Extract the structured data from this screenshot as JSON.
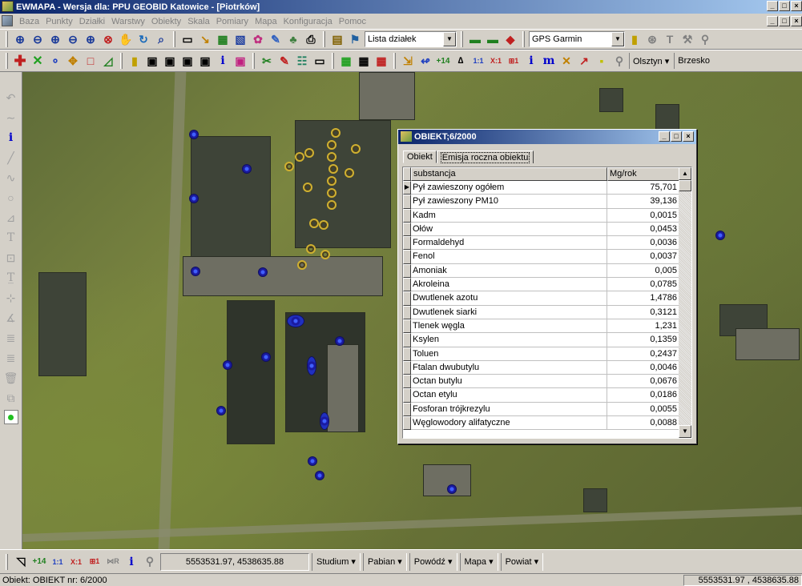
{
  "window": {
    "title": "EWMAPA - Wersja dla: PPU GEOBID Katowice - [Piotrków]",
    "minimize": "_",
    "maximize": "□",
    "close": "×"
  },
  "menu": [
    "Baza",
    "Punkty",
    "Działki",
    "Warstwy",
    "Obiekty",
    "Skala",
    "Pomiary",
    "Mapa",
    "Konfiguracja",
    "Pomoc"
  ],
  "toolbar1": {
    "lista_combo": "Lista działek",
    "gps_combo": "GPS Garmin"
  },
  "toolbar2": {
    "dropdown1": "Olsztyn ▾",
    "dropdown2": "Brzesko"
  },
  "left_tools": [
    "undo-icon",
    "redo-icon",
    "info-icon",
    "line-icon",
    "polyline-icon",
    "circle-icon",
    "measure-icon",
    "text-icon",
    "frame-icon",
    "text-edit-icon",
    "gap",
    "dim-icon",
    "angle-icon",
    "hatch-icon",
    "hatch2-icon",
    "trash-icon",
    "copy-icon",
    "point-icon"
  ],
  "dialog": {
    "title": "OBIEKT;6/2000",
    "tabs": [
      "Obiekt",
      "Emisja roczna obiektu"
    ],
    "columns": [
      "substancja",
      "Mg/rok"
    ],
    "rows": [
      {
        "name": "Pył zawieszony ogółem",
        "value": "75,701"
      },
      {
        "name": "Pył zawieszony PM10",
        "value": "39,136"
      },
      {
        "name": "Kadm",
        "value": "0,0015"
      },
      {
        "name": "Ołów",
        "value": "0,0453"
      },
      {
        "name": "Formaldehyd",
        "value": "0,0036"
      },
      {
        "name": "Fenol",
        "value": "0,0037"
      },
      {
        "name": "Amoniak",
        "value": "0,005"
      },
      {
        "name": "Akroleina",
        "value": "0,0785"
      },
      {
        "name": "Dwutlenek azotu",
        "value": "1,4786"
      },
      {
        "name": "Dwutlenek siarki",
        "value": "0,3121"
      },
      {
        "name": "Tlenek węgla",
        "value": "1,231"
      },
      {
        "name": "Ksylen",
        "value": "0,1359"
      },
      {
        "name": "Toluen",
        "value": "0,2437"
      },
      {
        "name": "Ftalan dwubutylu",
        "value": "0,0046"
      },
      {
        "name": "Octan butylu",
        "value": "0,0676"
      },
      {
        "name": "Octan etylu",
        "value": "0,0186"
      },
      {
        "name": "Fosforan trójkrezylu",
        "value": "0,0055"
      },
      {
        "name": "Węglowodory alifatyczne",
        "value": "0,0088"
      }
    ]
  },
  "bottom": {
    "coords": "5553531.97, 4538635.88",
    "studium": "Studium ▾",
    "pabian": "Pabian ▾",
    "powodz": "Powódź ▾",
    "mapa": "Mapa ▾",
    "powiat": "Powiat ▾"
  },
  "status": {
    "left": "Obiekt: OBIEKT   nr: 6/2000",
    "right": "5553531.97 , 4538635.88"
  }
}
